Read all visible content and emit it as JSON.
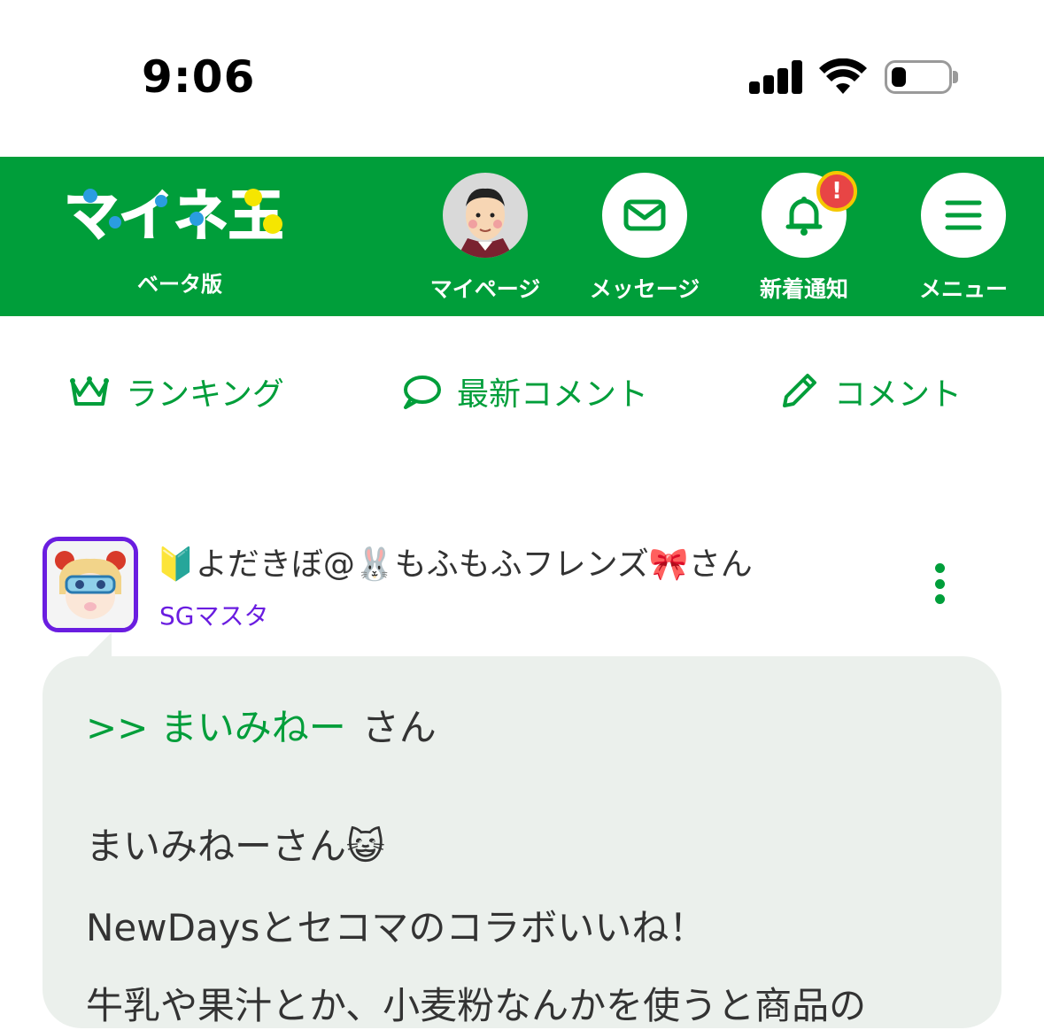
{
  "status_bar": {
    "time": "9:06",
    "battery_level": 0.25
  },
  "header": {
    "logo_text": "マイネ王",
    "logo_sub": "ベータ版",
    "nav": [
      {
        "label": "マイページ",
        "icon": "avatar-icon"
      },
      {
        "label": "メッセージ",
        "icon": "mail-icon"
      },
      {
        "label": "新着通知",
        "icon": "bell-icon",
        "badge": "!"
      },
      {
        "label": "メニュー",
        "icon": "hamburger-icon"
      }
    ]
  },
  "tabs": [
    {
      "label": "ランキング",
      "icon": "crown-icon"
    },
    {
      "label": "最新コメント",
      "icon": "speech-bubble-icon"
    },
    {
      "label": "コメント",
      "icon": "pencil-icon"
    }
  ],
  "post": {
    "username": "🔰よだきぼ@🐰もふもふフレンズ🎀さん",
    "rank": "SGマスタ",
    "reply_mention": ">> まいみねー",
    "reply_suffix": "さん",
    "lines": [
      "まいみねーさん😺",
      "NewDaysとセコマのコラボいいね！",
      "牛乳や果汁とか、小麦粉なんかを使うと商品の"
    ]
  },
  "colors": {
    "brand_green": "#009e3a",
    "rank_purple": "#6a1de0",
    "bubble_bg": "#ebf0ec",
    "badge_red": "#e84545",
    "badge_ring": "#f5c800"
  }
}
